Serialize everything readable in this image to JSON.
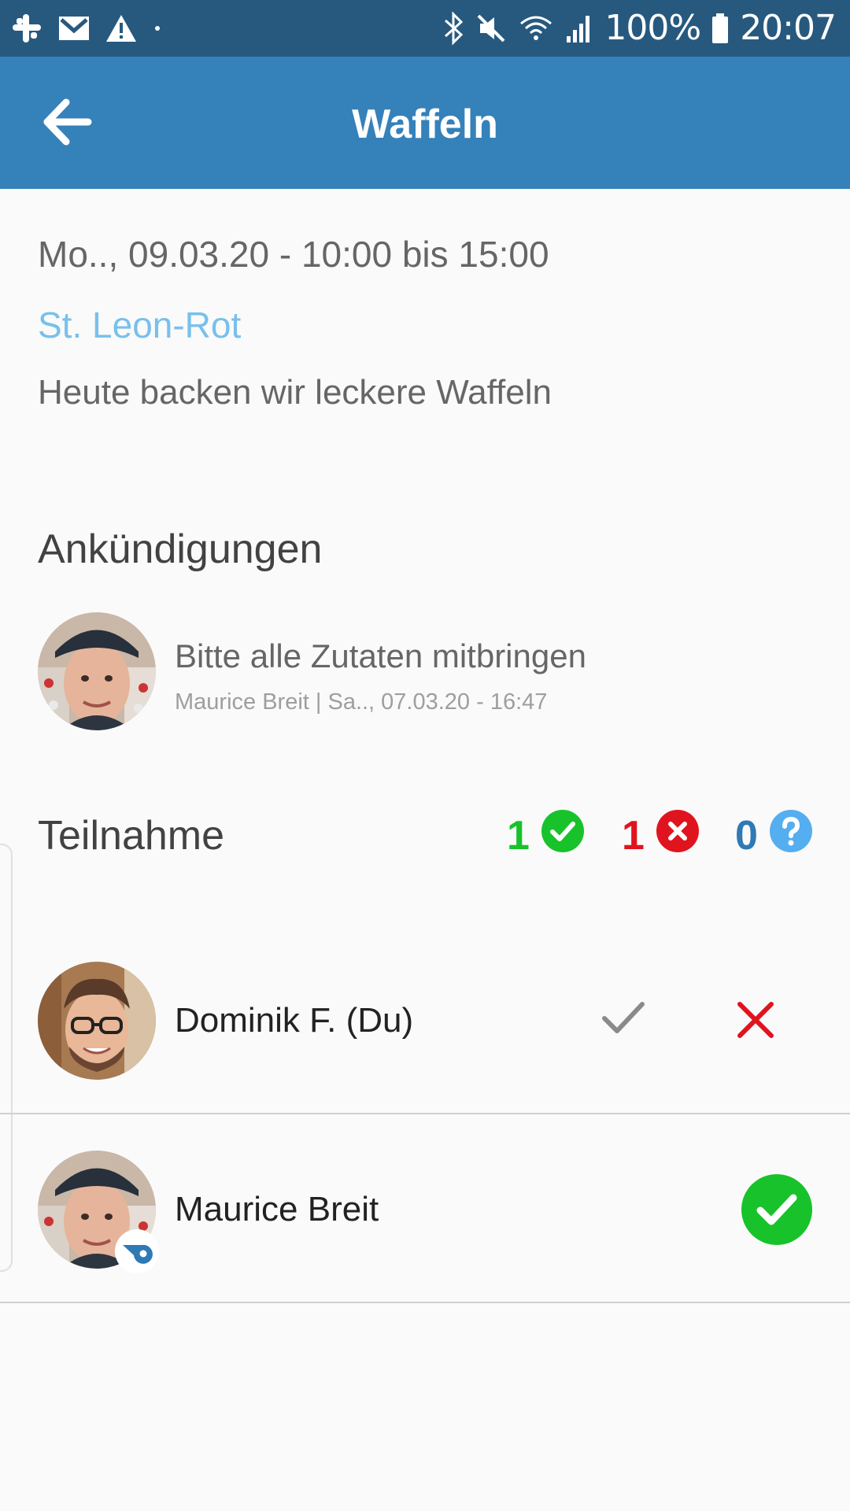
{
  "status_bar": {
    "battery": "100%",
    "time": "20:07"
  },
  "app_bar": {
    "title": "Waffeln"
  },
  "event": {
    "date_time": "Mo.., 09.03.20 - 10:00 bis 15:00",
    "location": "St. Leon-Rot",
    "description": "Heute backen wir leckere Waffeln"
  },
  "announcements": {
    "heading": "Ankündigungen",
    "items": [
      {
        "text": "Bitte alle Zutaten mitbringen",
        "meta": "Maurice Breit | Sa.., 07.03.20 - 16:47"
      }
    ]
  },
  "participation": {
    "heading": "Teilnahme",
    "counts": {
      "yes": "1",
      "no": "1",
      "unknown": "0"
    },
    "participants": [
      {
        "name": "Dominik F. (Du)",
        "state": "unanswered"
      },
      {
        "name": "Maurice Breit",
        "state": "yes",
        "badge": "whistle-icon"
      }
    ]
  },
  "colors": {
    "status_bar": "#27597f",
    "app_bar": "#3581ba",
    "yes": "#18c22a",
    "no": "#e0141e",
    "unknown_text": "#2f79b5",
    "unknown_icon": "#54aef0",
    "link": "#78c0ec"
  }
}
